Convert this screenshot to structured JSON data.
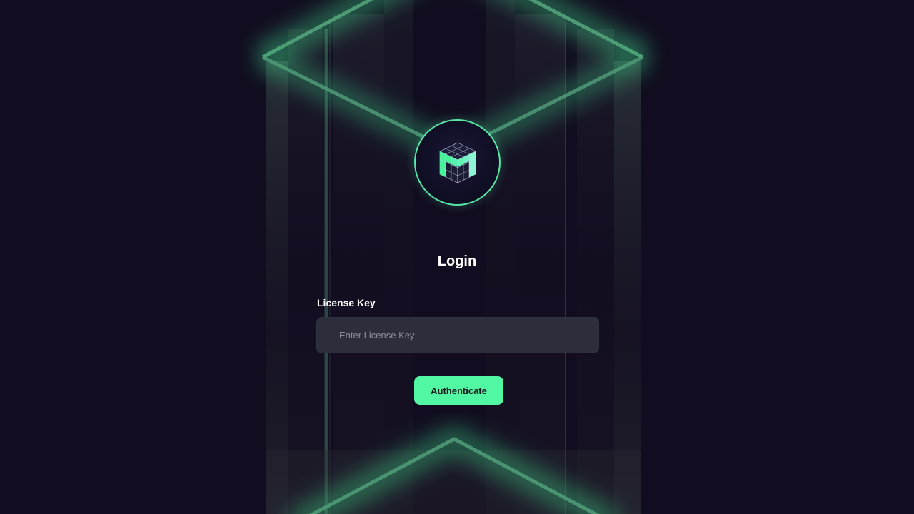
{
  "login": {
    "title": "Login",
    "license_label": "License Key",
    "license_placeholder": "Enter License Key",
    "license_value": "",
    "submit_label": "Authenticate"
  },
  "logo": {
    "icon": "cube-grid-logo-icon"
  },
  "colors": {
    "background": "#110c1f",
    "accent": "#52f7a3",
    "accent_glow": "#3ddc8c",
    "input_background": "#2c2e3b",
    "text": "#ffffff",
    "placeholder": "#8a8c98"
  }
}
